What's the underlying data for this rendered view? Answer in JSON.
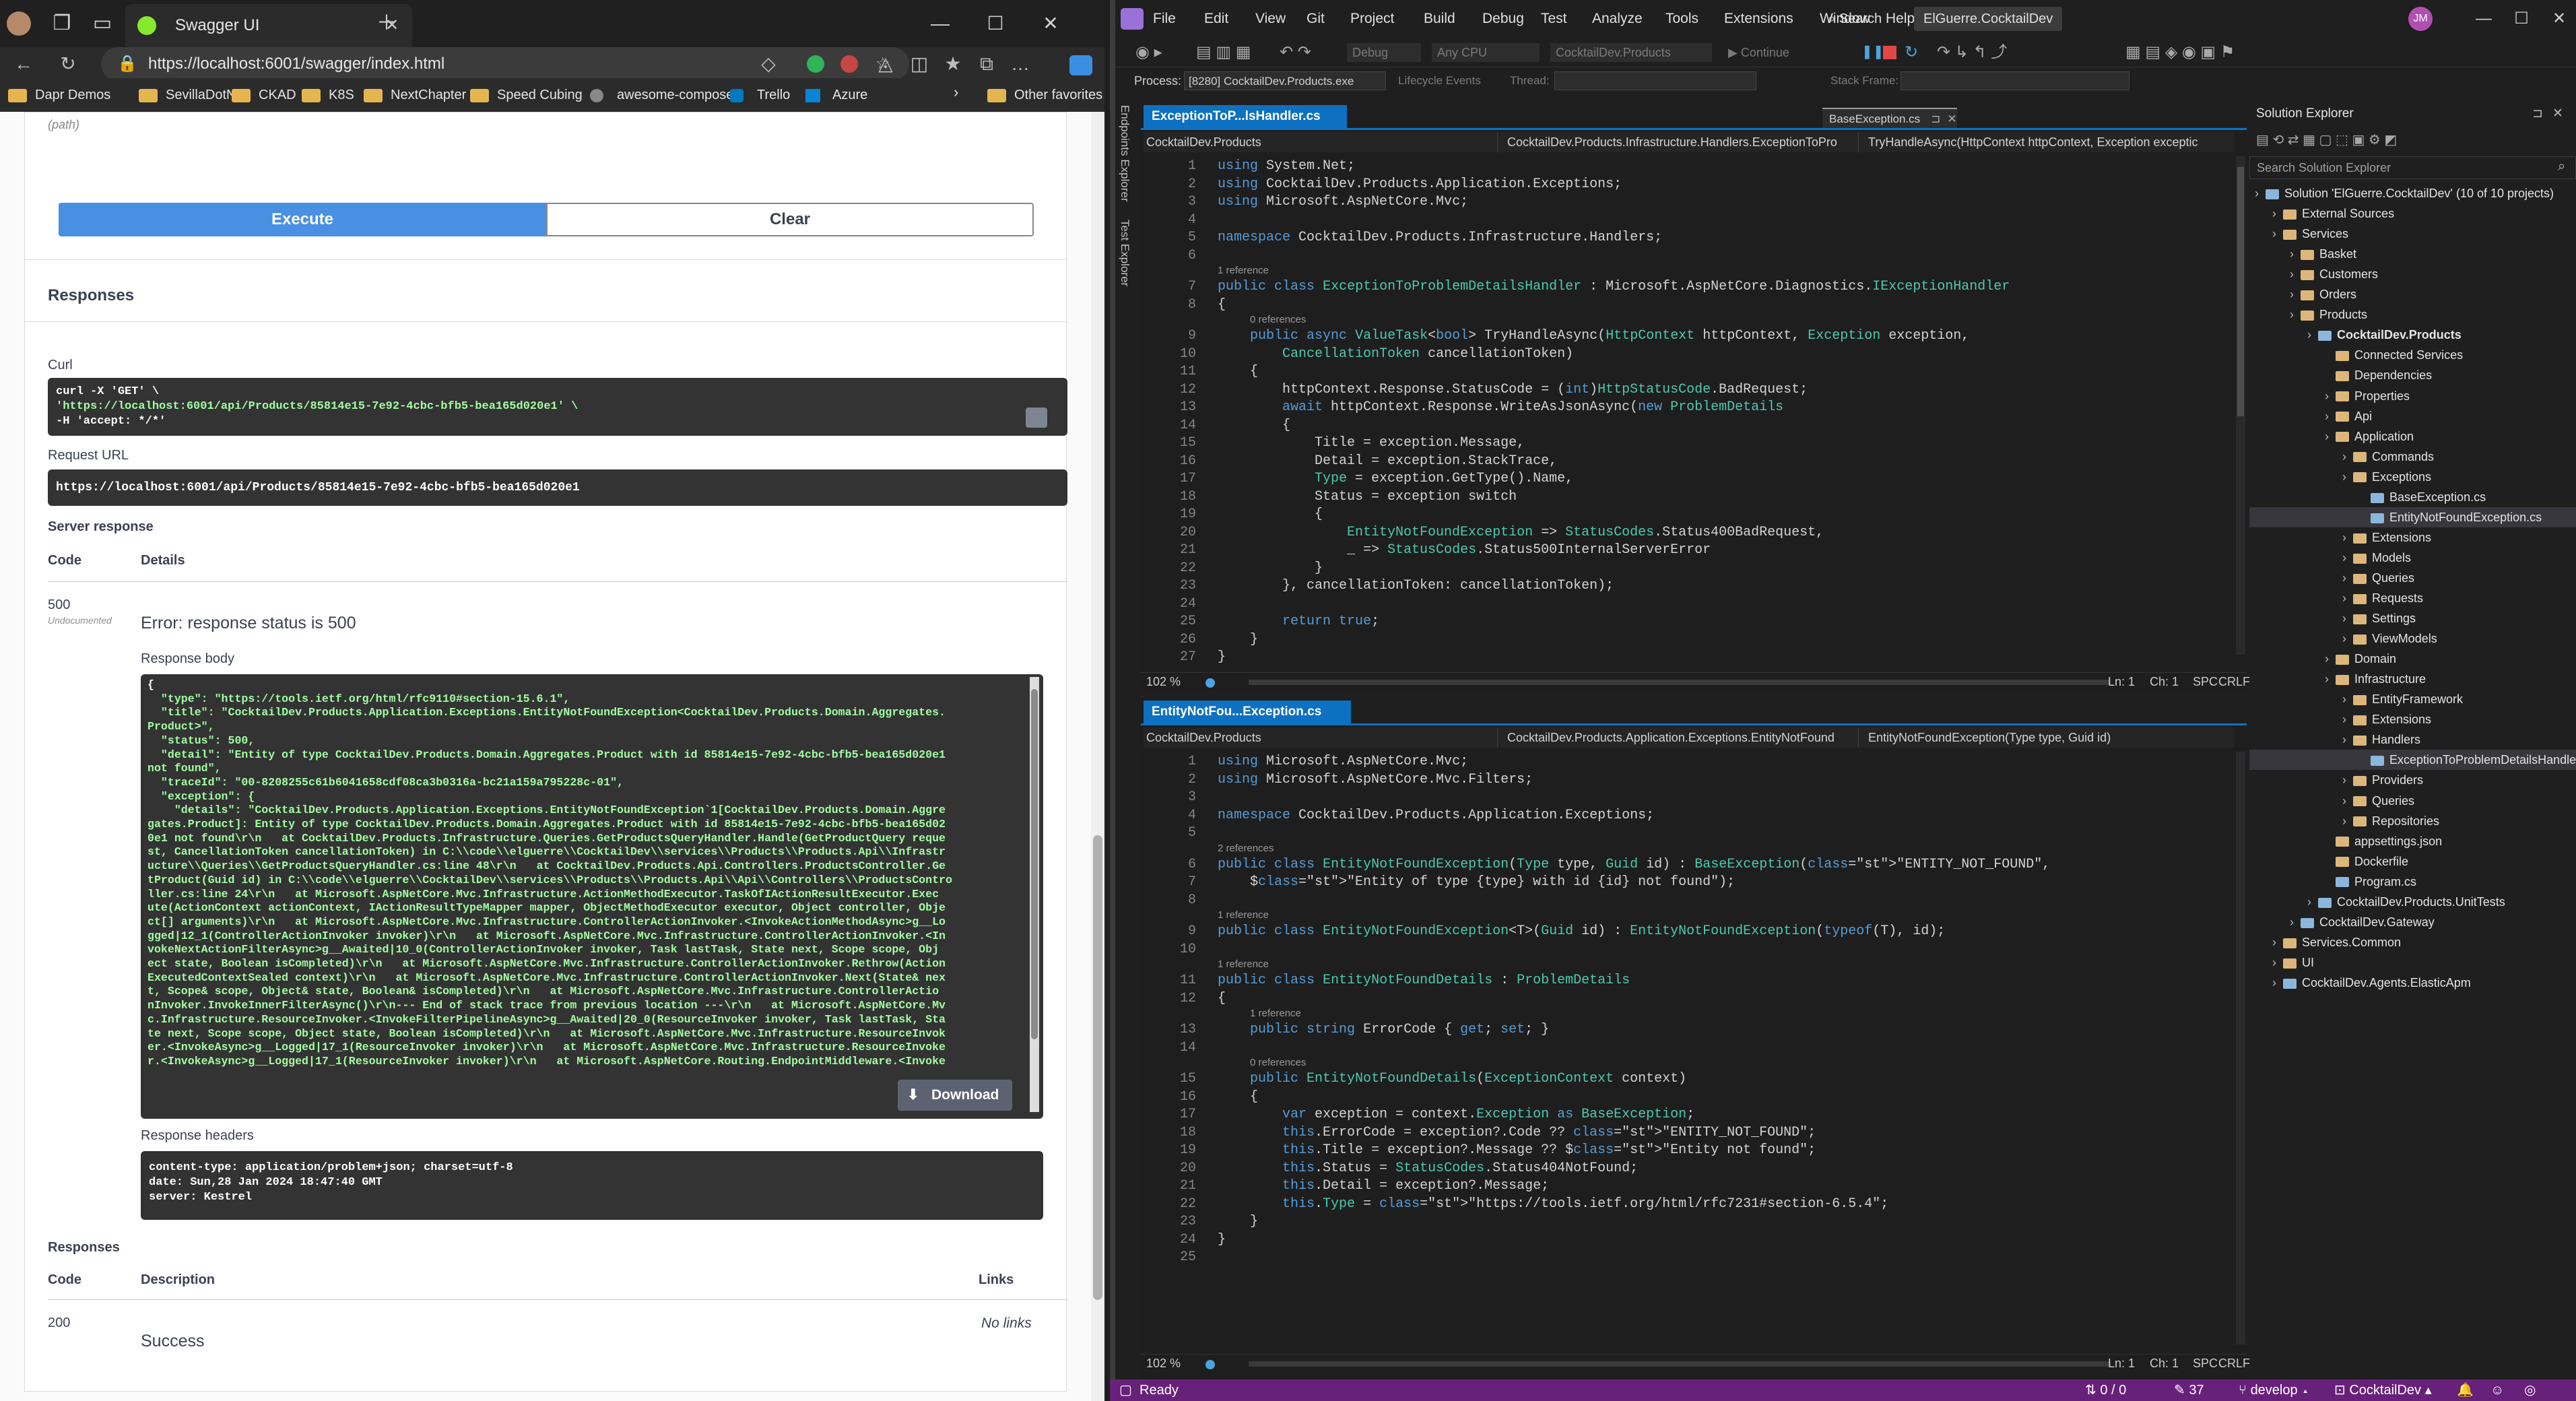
{
  "browser": {
    "tab_title": "Swagger UI",
    "url": "https://localhost:6001/swagger/index.html",
    "favorites": [
      "Dapr Demos",
      "SevillaDotNet",
      "CKAD",
      "K8S",
      "NextChapter",
      "Speed Cubing",
      "awesome-compose",
      "Trello",
      "Azure"
    ],
    "other_favorites": "Other favorites",
    "colors": {
      "swagger_green": "#85ea2d",
      "execute_blue": "#4990e2"
    }
  },
  "swagger": {
    "path_hint": "(path)",
    "execute_label": "Execute",
    "clear_label": "Clear",
    "responses_heading": "Responses",
    "curl_label": "Curl",
    "curl_lines": [
      "curl -X 'GET' \\",
      "  'https://localhost:6001/api/Products/85814e15-7e92-4cbc-bfb5-bea165d020e1' \\",
      "  -H 'accept: */*'"
    ],
    "request_url_label": "Request URL",
    "request_url": "https://localhost:6001/api/Products/85814e15-7e92-4cbc-bfb5-bea165d020e1",
    "server_response_label": "Server response",
    "code_col": "Code",
    "details_col": "Details",
    "status_code": "500",
    "undocumented": "Undocumented",
    "error_text": "Error: response status is 500",
    "response_body_label": "Response body",
    "response_body_lines": [
      "{",
      "  \"type\": \"https://tools.ietf.org/html/rfc9110#section-15.6.1\",",
      "  \"title\": \"CocktailDev.Products.Application.Exceptions.EntityNotFoundException<CocktailDev.Products.Domain.Aggregates.",
      "Product>\",",
      "  \"status\": 500,",
      "  \"detail\": \"Entity of type CocktailDev.Products.Domain.Aggregates.Product with id 85814e15-7e92-4cbc-bfb5-bea165d020e1",
      "not found\",",
      "  \"traceId\": \"00-8208255c61b6041658cdf08ca3b0316a-bc21a159a795228c-01\",",
      "  \"exception\": {",
      "    \"details\": \"CocktailDev.Products.Application.Exceptions.EntityNotFoundException`1[CocktailDev.Products.Domain.Aggre",
      "gates.Product]: Entity of type CocktailDev.Products.Domain.Aggregates.Product with id 85814e15-7e92-4cbc-bfb5-bea165d02",
      "0e1 not found\\r\\n   at CocktailDev.Products.Infrastructure.Queries.GetProductsQueryHandler.Handle(GetProductQuery reque",
      "st, CancellationToken cancellationToken) in C:\\\\code\\\\elguerre\\\\CocktailDev\\\\services\\\\Products\\\\Products.Api\\\\Infrastr",
      "ucture\\\\Queries\\\\GetProductsQueryHandler.cs:line 48\\r\\n   at CocktailDev.Products.Api.Controllers.ProductsController.Ge",
      "tProduct(Guid id) in C:\\\\code\\\\elguerre\\\\CocktailDev\\\\services\\\\Products\\\\Products.Api\\\\Api\\\\Controllers\\\\ProductsContro",
      "ller.cs:line 24\\r\\n   at Microsoft.AspNetCore.Mvc.Infrastructure.ActionMethodExecutor.TaskOfIActionResultExecutor.Exec",
      "ute(ActionContext actionContext, IActionResultTypeMapper mapper, ObjectMethodExecutor executor, Object controller, Obje",
      "ct[] arguments)\\r\\n   at Microsoft.AspNetCore.Mvc.Infrastructure.ControllerActionInvoker.<InvokeActionMethodAsync>g__Lo",
      "gged|12_1(ControllerActionInvoker invoker)\\r\\n   at Microsoft.AspNetCore.Mvc.Infrastructure.ControllerActionInvoker.<In",
      "vokeNextActionFilterAsync>g__Awaited|10_0(ControllerActionInvoker invoker, Task lastTask, State next, Scope scope, Obj",
      "ect state, Boolean isCompleted)\\r\\n   at Microsoft.AspNetCore.Mvc.Infrastructure.ControllerActionInvoker.Rethrow(Action",
      "ExecutedContextSealed context)\\r\\n   at Microsoft.AspNetCore.Mvc.Infrastructure.ControllerActionInvoker.Next(State& nex",
      "t, Scope& scope, Object& state, Boolean& isCompleted)\\r\\n   at Microsoft.AspNetCore.Mvc.Infrastructure.ControllerActio",
      "nInvoker.InvokeInnerFilterAsync()\\r\\n--- End of stack trace from previous location ---\\r\\n   at Microsoft.AspNetCore.Mv",
      "c.Infrastructure.ResourceInvoker.<InvokeFilterPipelineAsync>g__Awaited|20_0(ResourceInvoker invoker, Task lastTask, Sta",
      "te next, Scope scope, Object state, Boolean isCompleted)\\r\\n   at Microsoft.AspNetCore.Mvc.Infrastructure.ResourceInvok",
      "er.<InvokeAsync>g__Logged|17_1(ResourceInvoker invoker)\\r\\n   at Microsoft.AspNetCore.Mvc.Infrastructure.ResourceInvoke",
      "r.<InvokeAsync>g__Logged|17_1(ResourceInvoker invoker)\\r\\n   at Microsoft.AspNetCore.Routing.EndpointMiddleware.<Invoke"
    ],
    "download_label": "Download",
    "response_headers_label": "Response headers",
    "response_headers_lines": [
      " content-type: application/problem+json; charset=utf-8",
      " date: Sun,28 Jan 2024 18:47:40 GMT",
      " server: Kestrel"
    ],
    "responses2_heading": "Responses",
    "description_col": "Description",
    "links_col": "Links",
    "success_code": "200",
    "success_desc": "Success",
    "no_links": "No links"
  },
  "vs": {
    "menu": [
      "File",
      "Edit",
      "View",
      "Git",
      "Project",
      "Build",
      "Debug",
      "Test",
      "Analyze",
      "Tools",
      "Extensions",
      "Window",
      "Help"
    ],
    "search": "Search",
    "solution_title": "ElGuerre.CocktailDev",
    "avatar_initials": "JM",
    "config": "Debug",
    "platform": "Any CPU",
    "startup": "CocktailDev.Products",
    "continue": "Continue",
    "process_label": "Process:",
    "process_value": "[8280] CocktailDev.Products.exe",
    "lifecycle": "Lifecycle Events",
    "thread_label": "Thread:",
    "stackframe_label": "Stack Frame:",
    "side_tabs": [
      "Endpoints Explorer",
      "Test Explorer"
    ],
    "top_editor": {
      "tab": "ExceptionToP...lsHandler.cs",
      "tab2": "BaseException.cs",
      "nav": [
        "CocktailDev.Products",
        "CocktailDev.Products.Infrastructure.Handlers.ExceptionToPro",
        "TryHandleAsync(HttpContext httpContext, Exception exceptic"
      ],
      "zoom": "102 %",
      "ln": "Ln: 1",
      "ch": "Ch: 1",
      "enc": "SPC",
      "eol": "CRLF",
      "refs": [
        "1 reference",
        "0 references"
      ],
      "lines": [
        "using System.Net;",
        "using CocktailDev.Products.Application.Exceptions;",
        "using Microsoft.AspNetCore.Mvc;",
        "",
        "namespace CocktailDev.Products.Infrastructure.Handlers;",
        "",
        "public class ExceptionToProblemDetailsHandler : Microsoft.AspNetCore.Diagnostics.IExceptionHandler",
        "{",
        "    public async ValueTask<bool> TryHandleAsync(HttpContext httpContext, Exception exception,",
        "        CancellationToken cancellationToken)",
        "    {",
        "        httpContext.Response.StatusCode = (int)HttpStatusCode.BadRequest;",
        "        await httpContext.Response.WriteAsJsonAsync(new ProblemDetails",
        "        {",
        "            Title = exception.Message,",
        "            Detail = exception.StackTrace,",
        "            Type = exception.GetType().Name,",
        "            Status = exception switch",
        "            {",
        "                EntityNotFoundException => StatusCodes.Status400BadRequest,",
        "                _ => StatusCodes.Status500InternalServerError",
        "            }",
        "        }, cancellationToken: cancellationToken);",
        "",
        "        return true;",
        "    }",
        "}",
        ""
      ]
    },
    "bottom_editor": {
      "tab": "EntityNotFou...Exception.cs",
      "nav": [
        "CocktailDev.Products",
        "CocktailDev.Products.Application.Exceptions.EntityNotFound",
        "EntityNotFoundException(Type type, Guid id)"
      ],
      "zoom": "102 %",
      "ln": "Ln: 1",
      "ch": "Ch: 1",
      "enc": "SPC",
      "eol": "CRLF",
      "refs": [
        "2 references",
        "1 reference",
        "1 reference",
        "1 reference",
        "0 references"
      ],
      "lines": [
        "using Microsoft.AspNetCore.Mvc;",
        "using Microsoft.AspNetCore.Mvc.Filters;",
        "",
        "namespace CocktailDev.Products.Application.Exceptions;",
        "",
        "public class EntityNotFoundException(Type type, Guid id) : BaseException(\"ENTITY_NOT_FOUND\",",
        "    $\"Entity of type {type} with id {id} not found\");",
        "",
        "public class EntityNotFoundException<T>(Guid id) : EntityNotFoundException(typeof(T), id);",
        "",
        "public class EntityNotFoundDetails : ProblemDetails",
        "{",
        "    public string ErrorCode { get; set; }",
        "",
        "    public EntityNotFoundDetails(ExceptionContext context)",
        "    {",
        "        var exception = context.Exception as BaseException;",
        "        this.ErrorCode = exception?.Code ?? \"ENTITY_NOT_FOUND\";",
        "        this.Title = exception?.Message ?? $\"Entity not found\";",
        "        this.Status = StatusCodes.Status404NotFound;",
        "        this.Detail = exception?.Message;",
        "        this.Type = \"https://tools.ietf.org/html/rfc7231#section-6.5.4\";",
        "    }",
        "}",
        ""
      ]
    },
    "solution_explorer": {
      "title": "Solution Explorer",
      "search_placeholder": "Search Solution Explorer",
      "items": [
        {
          "label": "Solution 'ElGuerre.CocktailDev' (10 of 10 projects)",
          "depth": 0,
          "kind": "sln"
        },
        {
          "label": "External Sources",
          "depth": 1,
          "kind": "folder"
        },
        {
          "label": "Services",
          "depth": 1,
          "kind": "folder"
        },
        {
          "label": "Basket",
          "depth": 2,
          "kind": "folder"
        },
        {
          "label": "Customers",
          "depth": 2,
          "kind": "folder"
        },
        {
          "label": "Orders",
          "depth": 2,
          "kind": "folder"
        },
        {
          "label": "Products",
          "depth": 2,
          "kind": "folder"
        },
        {
          "label": "CocktailDev.Products",
          "depth": 3,
          "kind": "proj"
        },
        {
          "label": "Connected Services",
          "depth": 4,
          "kind": "item"
        },
        {
          "label": "Dependencies",
          "depth": 4,
          "kind": "item"
        },
        {
          "label": "Properties",
          "depth": 4,
          "kind": "folder"
        },
        {
          "label": "Api",
          "depth": 4,
          "kind": "folder"
        },
        {
          "label": "Application",
          "depth": 4,
          "kind": "folder"
        },
        {
          "label": "Commands",
          "depth": 5,
          "kind": "folder"
        },
        {
          "label": "Exceptions",
          "depth": 5,
          "kind": "folder"
        },
        {
          "label": "BaseException.cs",
          "depth": 6,
          "kind": "cs"
        },
        {
          "label": "EntityNotFoundException.cs",
          "depth": 6,
          "kind": "cs"
        },
        {
          "label": "Extensions",
          "depth": 5,
          "kind": "folder"
        },
        {
          "label": "Models",
          "depth": 5,
          "kind": "folder"
        },
        {
          "label": "Queries",
          "depth": 5,
          "kind": "folder"
        },
        {
          "label": "Requests",
          "depth": 5,
          "kind": "folder"
        },
        {
          "label": "Settings",
          "depth": 5,
          "kind": "folder"
        },
        {
          "label": "ViewModels",
          "depth": 5,
          "kind": "folder"
        },
        {
          "label": "Domain",
          "depth": 4,
          "kind": "folder"
        },
        {
          "label": "Infrastructure",
          "depth": 4,
          "kind": "folder"
        },
        {
          "label": "EntityFramework",
          "depth": 5,
          "kind": "folder"
        },
        {
          "label": "Extensions",
          "depth": 5,
          "kind": "folder"
        },
        {
          "label": "Handlers",
          "depth": 5,
          "kind": "folder"
        },
        {
          "label": "ExceptionToProblemDetailsHandle",
          "depth": 6,
          "kind": "cs"
        },
        {
          "label": "Providers",
          "depth": 5,
          "kind": "folder"
        },
        {
          "label": "Queries",
          "depth": 5,
          "kind": "folder"
        },
        {
          "label": "Repositories",
          "depth": 5,
          "kind": "folder"
        },
        {
          "label": "appsettings.json",
          "depth": 4,
          "kind": "item"
        },
        {
          "label": "Dockerfile",
          "depth": 4,
          "kind": "item"
        },
        {
          "label": "Program.cs",
          "depth": 4,
          "kind": "cs"
        },
        {
          "label": "CocktailDev.Products.UnitTests",
          "depth": 3,
          "kind": "proj"
        },
        {
          "label": "CocktailDev.Gateway",
          "depth": 2,
          "kind": "proj"
        },
        {
          "label": "Services.Common",
          "depth": 1,
          "kind": "folder"
        },
        {
          "label": "UI",
          "depth": 1,
          "kind": "folder"
        },
        {
          "label": "CocktailDev.Agents.ElasticApm",
          "depth": 1,
          "kind": "proj"
        }
      ]
    },
    "status": {
      "ready": "Ready",
      "errors": "0 / 0",
      "changes": "37",
      "branch": "develop",
      "repo": "CocktailDev"
    },
    "colors": {
      "accent": "#0e70c0",
      "status_bar": "#68217a"
    }
  }
}
